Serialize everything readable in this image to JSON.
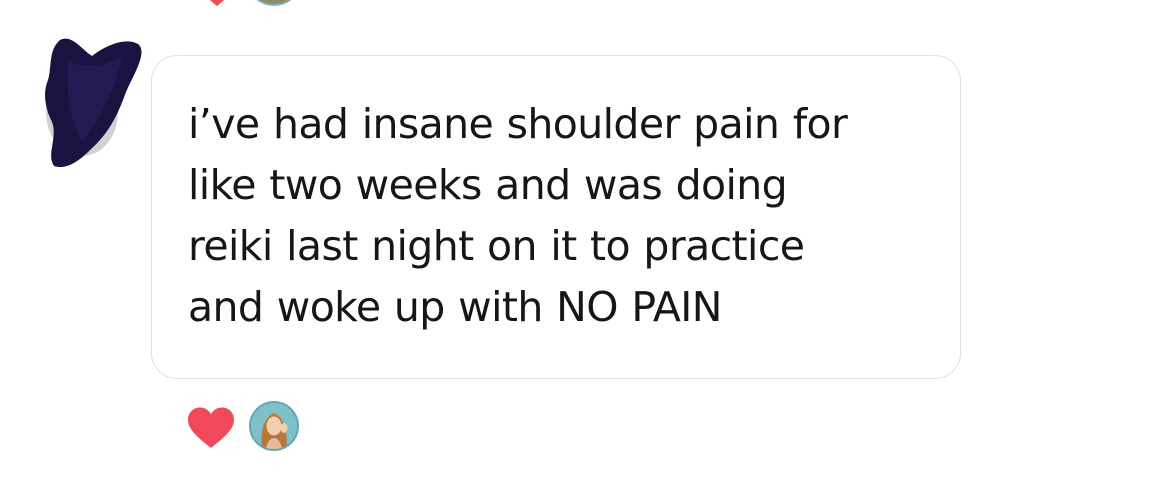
{
  "message": {
    "text": "i’ve had insane shoulder pain for\nlike two weeks and was doing\nreiki last night on it to practice\nand woke up with NO PAIN"
  },
  "reactions": {
    "icon": "heart-icon",
    "color": "#f04a5a"
  },
  "colors": {
    "bubble_border": "#e1e1e1",
    "text": "#161616",
    "avatar_ring": "#5fa9b5",
    "redaction": "#1a1240"
  }
}
